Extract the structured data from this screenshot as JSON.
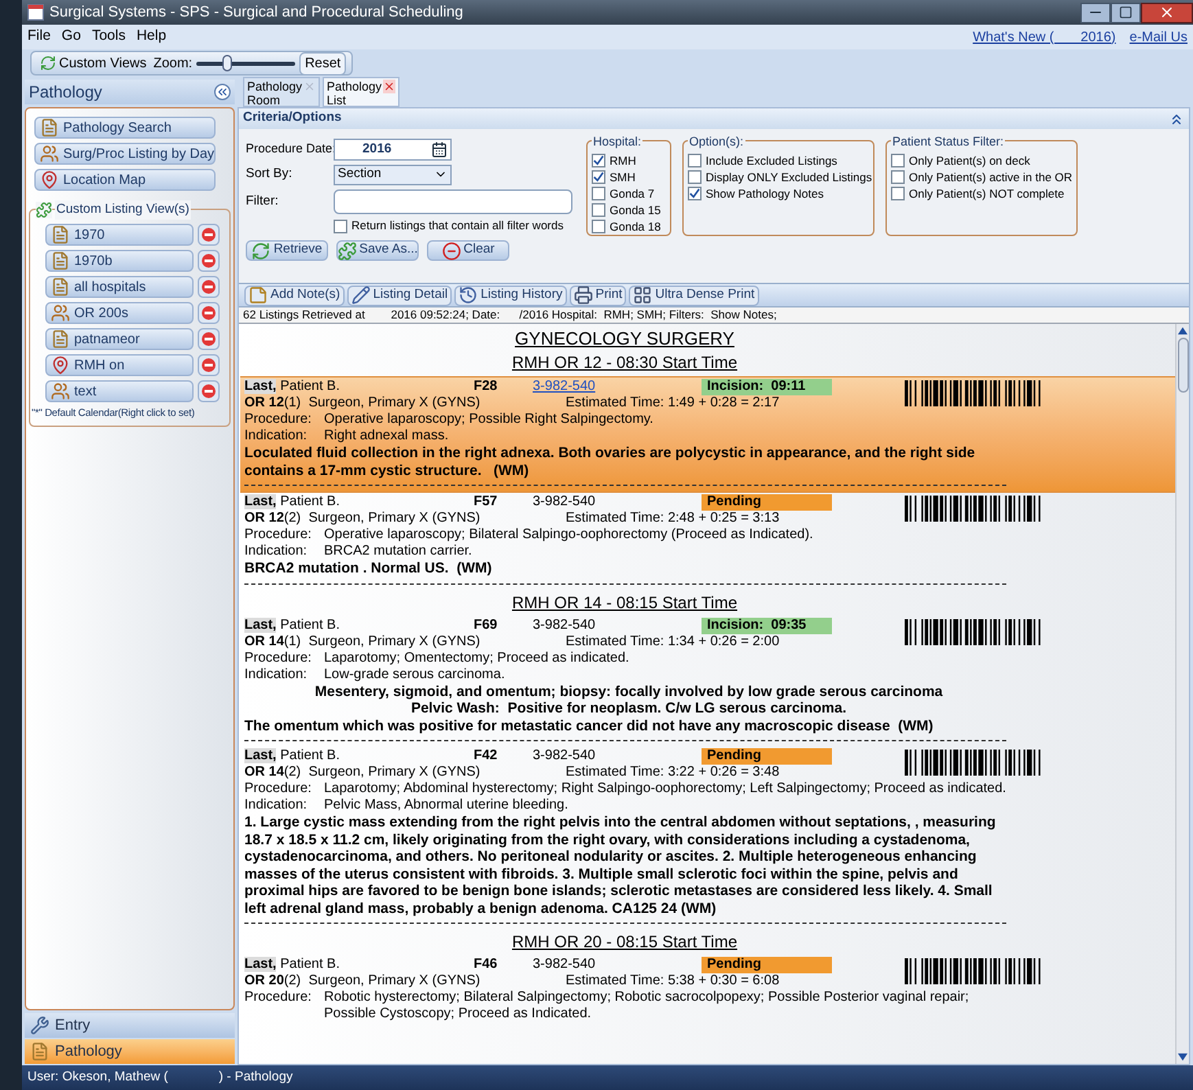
{
  "window": {
    "title": "Surgical Systems - SPS - Surgical and Procedural Scheduling"
  },
  "menu": [
    "File",
    "Go",
    "Tools",
    "Help"
  ],
  "header_links": [
    "What's New (       2016)",
    "e-Mail Us"
  ],
  "toolbar": {
    "custom_views": "Custom Views",
    "zoom": {
      "label": "Zoom:",
      "level": 0.3
    },
    "reset": "Reset"
  },
  "sidebar": {
    "title": "Pathology",
    "buttons": [
      "Pathology Search",
      "Surg/Proc Listing by Day",
      "Location Map"
    ],
    "custom_group": {
      "title": "Custom Listing View(s)",
      "views": [
        "1970",
        "1970b",
        "all hospitals",
        "OR 200s",
        "patnameor",
        "RMH on",
        "text"
      ]
    },
    "note": "\"*\" Default Calendar(Right click to set)",
    "nav": [
      {
        "label": "Entry",
        "selected": false
      },
      {
        "label": "Pathology",
        "selected": true
      }
    ]
  },
  "tabs": [
    {
      "label": "Pathology Room",
      "selected": false
    },
    {
      "label": "Pathology List",
      "selected": true
    }
  ],
  "criteria": {
    "title": "Criteria/Options",
    "procedure_date": {
      "label": "Procedure Date:",
      "value": "2016"
    },
    "sort_by": {
      "label": "Sort By:",
      "value": "Section"
    },
    "filter": {
      "label": "Filter:"
    },
    "match_all": {
      "label": "Return listings that contain all filter words",
      "checked": false
    },
    "buttons": [
      "Retrieve",
      "Save As...",
      "Clear"
    ],
    "groups": [
      {
        "title": "Hospital:",
        "items": [
          {
            "label": "RMH",
            "checked": true
          },
          {
            "label": "SMH",
            "checked": true
          },
          {
            "label": "Gonda 7",
            "checked": false
          },
          {
            "label": "Gonda 15",
            "checked": false
          },
          {
            "label": "Gonda 18",
            "checked": false
          }
        ]
      },
      {
        "title": "Option(s):",
        "items": [
          {
            "label": "Include Excluded Listings",
            "checked": false
          },
          {
            "label": "Display ONLY Excluded Listings",
            "checked": false
          },
          {
            "label": "Show Pathology Notes",
            "checked": true
          }
        ]
      },
      {
        "title": "Patient Status Filter:",
        "items": [
          {
            "label": "Only Patient(s) on deck",
            "checked": false
          },
          {
            "label": "Only Patient(s) active in the OR",
            "checked": false
          },
          {
            "label": "Only Patient(s) NOT complete",
            "checked": false
          }
        ]
      }
    ]
  },
  "actions": [
    "Add Note(s)",
    "Listing Detail",
    "Listing History",
    "Print",
    "Ultra Dense Print"
  ],
  "retrieval_info": "62 Listings Retrieved at        2016 09:52:24; Date:      /2016 Hospital:  RMH; SMH; Filters:  Show Notes;",
  "listing": {
    "title": "GYNECOLOGY SURGERY",
    "sections": [
      {
        "title": "RMH OR 12 - 08:30 Start Time",
        "entries": [
          {
            "highlighted": true,
            "last": "Last,",
            "first": "Patient B.",
            "code": "F28",
            "mrn": "3-982-540",
            "mrn_link": true,
            "status": {
              "kind": "incision",
              "text": "Incision:  09:11"
            },
            "room": "**OR 12**(1)",
            "surgeon": "Surgeon, Primary X (GYNS)",
            "estimate": "Estimated Time: 1:49 + 0:28 = 2:17",
            "procedure_label": "Procedure:",
            "procedure": "Operative laparoscopy; Possible Right Salpingectomy.",
            "indication_label": "Indication:",
            "indication": "Right adnexal mass.",
            "notes": [
              {
                "text": "Loculated fluid collection in the right adnexa. Both ovaries are polycystic in appearance, and the right side contains a 17-mm cystic structure.   (WM)",
                "kind": "plain"
              }
            ]
          },
          {
            "highlighted": false,
            "last": "Last,",
            "first": "Patient B.",
            "code": "F57",
            "mrn": "3-982-540",
            "mrn_link": false,
            "status": {
              "kind": "pending",
              "text": "Pending"
            },
            "room": "**OR 12**(2)",
            "surgeon": "Surgeon, Primary X (GYNS)",
            "estimate": "Estimated Time: 2:48 + 0:25 = 3:13",
            "procedure_label": "Procedure:",
            "procedure": "Operative laparoscopy; Bilateral Salpingo-oophorectomy (Proceed as Indicated).",
            "indication_label": "Indication:",
            "indication": "BRCA2 mutation carrier.",
            "notes": [
              {
                "text": "BRCA2 mutation . Normal US.  (WM)",
                "kind": "plain"
              }
            ]
          }
        ]
      },
      {
        "title": "RMH OR 14 - 08:15 Start Time",
        "entries": [
          {
            "highlighted": false,
            "last": "Last,",
            "first": "Patient B.",
            "code": "F69",
            "mrn": "3-982-540",
            "mrn_link": false,
            "status": {
              "kind": "incision",
              "text": "Incision:  09:35"
            },
            "room": "**OR 14**(1)",
            "surgeon": "Surgeon, Primary X (GYNS)",
            "estimate": "Estimated Time: 1:34 + 0:26 = 2:00",
            "procedure_label": "Procedure:",
            "procedure": "Laparotomy; Omentectomy; Proceed as indicated.",
            "indication_label": "Indication:",
            "indication": "Low-grade serous carcinoma.",
            "notes": [
              {
                "text": "Mesentery, sigmoid, and omentum; biopsy: focally involved by low grade serous carcinoma",
                "kind": "centered"
              },
              {
                "text": "Pelvic Wash:  Positive for neoplasm. C/w LG serous carcinoma.",
                "kind": "centered"
              },
              {
                "text": "The omentum which was positive for metastatic cancer did not have any macroscopic disease  (WM)",
                "kind": "plain"
              }
            ]
          },
          {
            "highlighted": false,
            "last": "Last,",
            "first": "Patient B.",
            "code": "F42",
            "mrn": "3-982-540",
            "mrn_link": false,
            "status": {
              "kind": "pending",
              "text": "Pending"
            },
            "room": "**OR 14**(2)",
            "surgeon": "Surgeon, Primary X (GYNS)",
            "estimate": "Estimated Time: 3:22 + 0:26 = 3:48",
            "procedure_label": "Procedure:",
            "procedure": "Laparotomy; Abdominal hysterectomy; Right Salpingo-oophorectomy; Left Salpingectomy; Proceed as indicated.",
            "indication_label": "Indication:",
            "indication": "Pelvic Mass, Abnormal uterine bleeding.",
            "notes": [
              {
                "text": "1. Large cystic mass extending from the right pelvis into the central abdomen without septations, , measuring 18.7 x 18.5 x 11.2 cm, likely originating from the right ovary, with considerations including a cystadenoma, cystadenocarcinoma, and others. No peritoneal nodularity or ascites. 2. Multiple heterogeneous enhancing masses of the uterus consistent with fibroids. 3. Multiple small sclerotic foci within the spine, pelvis and proximal hips are favored to be benign bone islands; sclerotic metastases are considered less likely. 4. Small left adrenal gland mass, probably a benign adenoma. CA125 24 (WM)",
                "kind": "plain"
              }
            ]
          }
        ]
      },
      {
        "title": "RMH OR 20 - 08:15 Start Time",
        "entries": [
          {
            "highlighted": false,
            "last": "Last,",
            "first": "Patient B.",
            "code": "F46",
            "mrn": "3-982-540",
            "mrn_link": false,
            "status": {
              "kind": "pending",
              "text": "Pending"
            },
            "room": "**OR 20**(2)",
            "surgeon": "Surgeon, Primary X (GYNS)",
            "estimate": "Estimated Time: 5:38 + 0:30 = 6:08",
            "procedure_label": "Procedure:",
            "procedure": "Robotic hysterectomy; Bilateral Salpingectomy; Robotic sacrocolpopexy; Possible Posterior vaginal repair; Possible Cystoscopy; Proceed as Indicated."
          }
        ]
      }
    ]
  },
  "status_bar": "User: Okeson, Mathew (              ) - Pathology"
}
